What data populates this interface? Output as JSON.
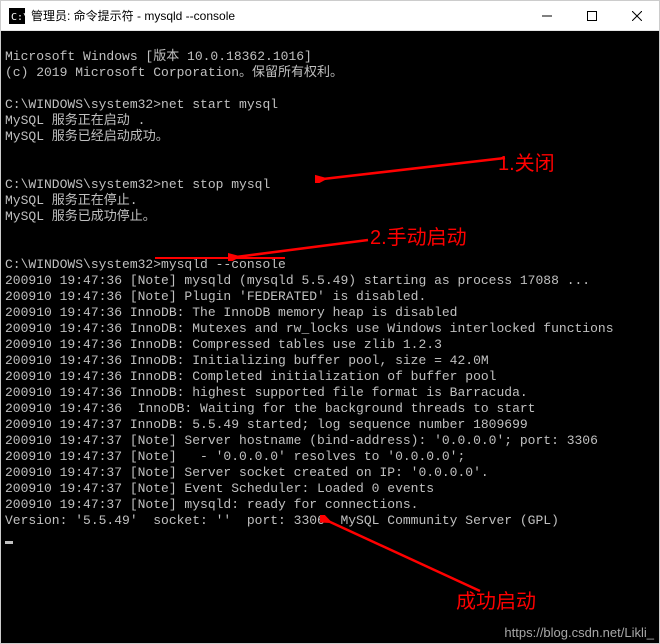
{
  "titlebar": {
    "title": "管理员: 命令提示符 - mysqld  --console"
  },
  "console": {
    "lines": [
      "Microsoft Windows [版本 10.0.18362.1016]",
      "(c) 2019 Microsoft Corporation。保留所有权利。",
      "",
      "C:\\WINDOWS\\system32>net start mysql",
      "MySQL 服务正在启动 .",
      "MySQL 服务已经启动成功。",
      "",
      "",
      "C:\\WINDOWS\\system32>net stop mysql",
      "MySQL 服务正在停止.",
      "MySQL 服务已成功停止。",
      "",
      "",
      "C:\\WINDOWS\\system32>mysqld --console",
      "200910 19:47:36 [Note] mysqld (mysqld 5.5.49) starting as process 17088 ...",
      "200910 19:47:36 [Note] Plugin 'FEDERATED' is disabled.",
      "200910 19:47:36 InnoDB: The InnoDB memory heap is disabled",
      "200910 19:47:36 InnoDB: Mutexes and rw_locks use Windows interlocked functions",
      "200910 19:47:36 InnoDB: Compressed tables use zlib 1.2.3",
      "200910 19:47:36 InnoDB: Initializing buffer pool, size = 42.0M",
      "200910 19:47:36 InnoDB: Completed initialization of buffer pool",
      "200910 19:47:36 InnoDB: highest supported file format is Barracuda.",
      "200910 19:47:36  InnoDB: Waiting for the background threads to start",
      "200910 19:47:37 InnoDB: 5.5.49 started; log sequence number 1809699",
      "200910 19:47:37 [Note] Server hostname (bind-address): '0.0.0.0'; port: 3306",
      "200910 19:47:37 [Note]   - '0.0.0.0' resolves to '0.0.0.0';",
      "200910 19:47:37 [Note] Server socket created on IP: '0.0.0.0'.",
      "200910 19:47:37 [Note] Event Scheduler: Loaded 0 events",
      "200910 19:47:37 [Note] mysqld: ready for connections.",
      "Version: '5.5.49'  socket: ''  port: 3306  MySQL Community Server (GPL)",
      ""
    ]
  },
  "annotations": {
    "a1": "1.关闭",
    "a2": "2.手动启动",
    "a3": "成功启动"
  },
  "watermark": "https://blog.csdn.net/Likli_"
}
